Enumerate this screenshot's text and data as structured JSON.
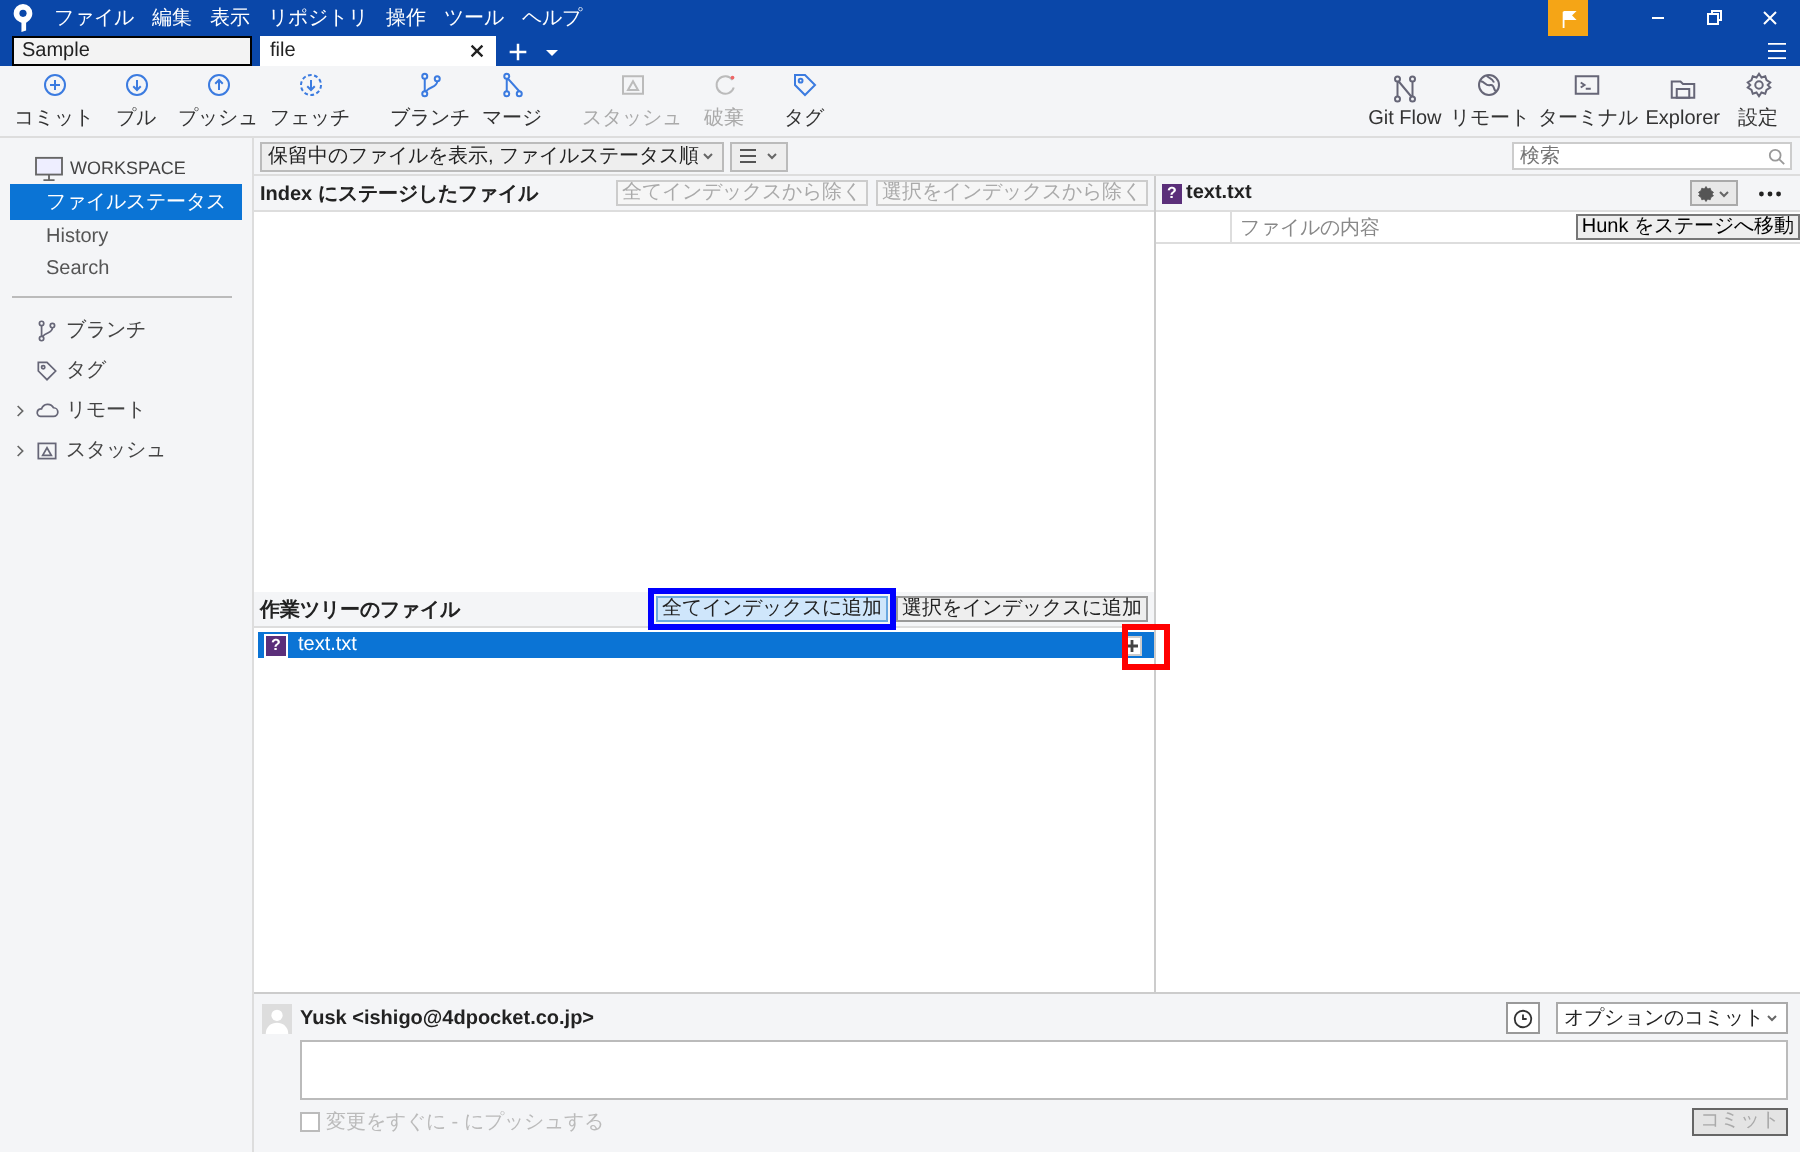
{
  "menu": [
    "ファイル",
    "編集",
    "表示",
    "リポジトリ",
    "操作",
    "ツール",
    "ヘルプ"
  ],
  "tabs": [
    {
      "label": "Sample",
      "selected": false,
      "closable": false
    },
    {
      "label": "file",
      "selected": true,
      "closable": true
    }
  ],
  "toolbar": [
    {
      "label": "コミット",
      "kind": "commit",
      "disabled": false
    },
    {
      "label": "プル",
      "kind": "pull",
      "disabled": false
    },
    {
      "label": "プッシュ",
      "kind": "push",
      "disabled": false
    },
    {
      "label": "フェッチ",
      "kind": "fetch",
      "disabled": false
    },
    {
      "label": "ブランチ",
      "kind": "branch",
      "disabled": false
    },
    {
      "label": "マージ",
      "kind": "merge",
      "disabled": false
    },
    {
      "label": "スタッシュ",
      "kind": "stash",
      "disabled": true
    },
    {
      "label": "破棄",
      "kind": "discard",
      "disabled": true
    },
    {
      "label": "タグ",
      "kind": "tag",
      "disabled": false
    }
  ],
  "toolbar_right": [
    {
      "label": "Git Flow",
      "kind": "gitflow"
    },
    {
      "label": "リモート",
      "kind": "globe"
    },
    {
      "label": "ターミナル",
      "kind": "terminal"
    },
    {
      "label": "Explorer",
      "kind": "folder"
    },
    {
      "label": "設定",
      "kind": "settings"
    }
  ],
  "sidebar": {
    "workspace": "WORKSPACE",
    "items": [
      {
        "label": "ファイルステータス",
        "selected": true
      },
      {
        "label": "History",
        "selected": false
      },
      {
        "label": "Search",
        "selected": false
      }
    ],
    "sections": [
      {
        "label": "ブランチ",
        "kind": "branch"
      },
      {
        "label": "タグ",
        "kind": "tag"
      },
      {
        "label": "リモート",
        "kind": "cloud",
        "expanded": false
      },
      {
        "label": "スタッシュ",
        "kind": "stash",
        "expanded": false
      }
    ]
  },
  "filter": {
    "label": "保留中のファイルを表示, ファイルステータス順",
    "search_placeholder": "検索"
  },
  "staged": {
    "title": "Index にステージしたファイル",
    "buttons": [
      {
        "label": "全てインデックスから除く",
        "disabled": true
      },
      {
        "label": "選択をインデックスから除く",
        "disabled": true
      }
    ]
  },
  "unstaged": {
    "title": "作業ツリーのファイル",
    "buttons": [
      {
        "label": "全てインデックスに追加",
        "disabled": false,
        "callout": {
          "color": "#0000ff"
        }
      },
      {
        "label": "選択をインデックスに追加",
        "disabled": false
      }
    ],
    "files": [
      {
        "name": "text.txt",
        "status_mark": "?",
        "selected": true,
        "stage_callout": {
          "color": "#ff0000"
        }
      }
    ]
  },
  "diff": {
    "file": "text.txt",
    "status_mark": "?",
    "column": "ファイルの内容",
    "hunk_button": "Hunk をステージへ移動"
  },
  "commit": {
    "author": "Yusk <ishigo@4dpocket.co.jp>",
    "options": "オプションのコミット",
    "push_label": "変更をすぐに - にプッシュする",
    "push_checked": false,
    "push_disabled": true,
    "commit_button": "コミット",
    "commit_disabled": true
  }
}
